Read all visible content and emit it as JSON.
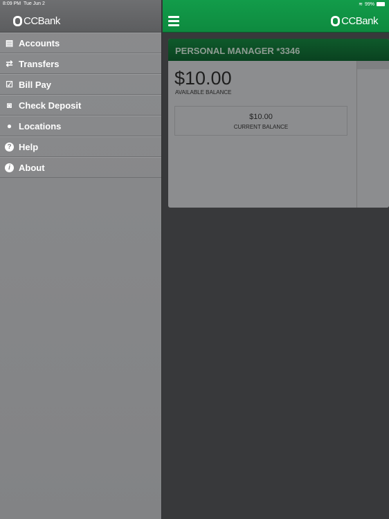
{
  "status_bar": {
    "time": "8:09 PM",
    "date": "Tue Jun 2",
    "battery": "99%"
  },
  "brand": {
    "name": "CCBank",
    "accent": "#119a48"
  },
  "sidebar": {
    "items": [
      {
        "label": "Accounts",
        "icon": "accounts-icon"
      },
      {
        "label": "Transfers",
        "icon": "transfers-icon"
      },
      {
        "label": "Bill Pay",
        "icon": "calendar-check-icon"
      },
      {
        "label": "Check Deposit",
        "icon": "camera-icon"
      },
      {
        "label": "Locations",
        "icon": "map-pin-icon"
      },
      {
        "label": "Help",
        "icon": "help-icon"
      },
      {
        "label": "About",
        "icon": "info-icon"
      }
    ]
  },
  "account": {
    "name": "PERSONAL MANAGER *3346",
    "available": "$10.00",
    "available_label": "AVAILABLE BALANCE",
    "current": "$10.00",
    "current_label": "CURRENT BALANCE"
  }
}
